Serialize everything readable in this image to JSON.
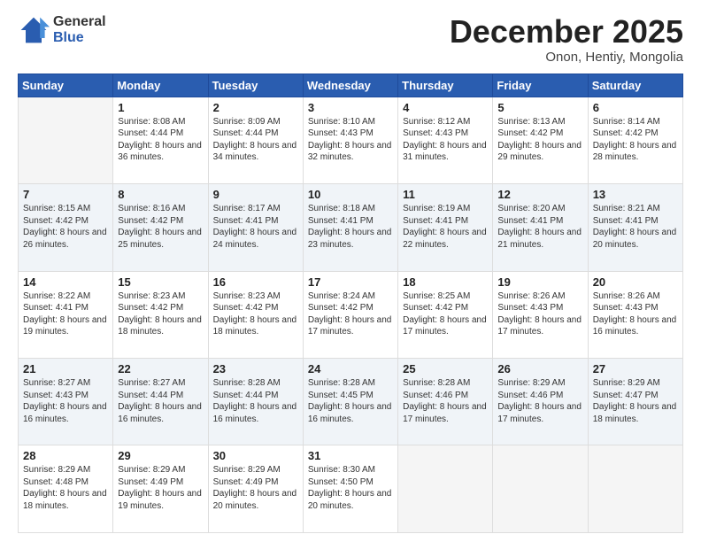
{
  "logo": {
    "general": "General",
    "blue": "Blue"
  },
  "header": {
    "month": "December 2025",
    "location": "Onon, Hentiy, Mongolia"
  },
  "weekdays": [
    "Sunday",
    "Monday",
    "Tuesday",
    "Wednesday",
    "Thursday",
    "Friday",
    "Saturday"
  ],
  "weeks": [
    [
      {
        "day": "",
        "empty": true
      },
      {
        "day": "1",
        "sunrise": "Sunrise: 8:08 AM",
        "sunset": "Sunset: 4:44 PM",
        "daylight": "Daylight: 8 hours and 36 minutes."
      },
      {
        "day": "2",
        "sunrise": "Sunrise: 8:09 AM",
        "sunset": "Sunset: 4:44 PM",
        "daylight": "Daylight: 8 hours and 34 minutes."
      },
      {
        "day": "3",
        "sunrise": "Sunrise: 8:10 AM",
        "sunset": "Sunset: 4:43 PM",
        "daylight": "Daylight: 8 hours and 32 minutes."
      },
      {
        "day": "4",
        "sunrise": "Sunrise: 8:12 AM",
        "sunset": "Sunset: 4:43 PM",
        "daylight": "Daylight: 8 hours and 31 minutes."
      },
      {
        "day": "5",
        "sunrise": "Sunrise: 8:13 AM",
        "sunset": "Sunset: 4:42 PM",
        "daylight": "Daylight: 8 hours and 29 minutes."
      },
      {
        "day": "6",
        "sunrise": "Sunrise: 8:14 AM",
        "sunset": "Sunset: 4:42 PM",
        "daylight": "Daylight: 8 hours and 28 minutes."
      }
    ],
    [
      {
        "day": "7",
        "sunrise": "Sunrise: 8:15 AM",
        "sunset": "Sunset: 4:42 PM",
        "daylight": "Daylight: 8 hours and 26 minutes."
      },
      {
        "day": "8",
        "sunrise": "Sunrise: 8:16 AM",
        "sunset": "Sunset: 4:42 PM",
        "daylight": "Daylight: 8 hours and 25 minutes."
      },
      {
        "day": "9",
        "sunrise": "Sunrise: 8:17 AM",
        "sunset": "Sunset: 4:41 PM",
        "daylight": "Daylight: 8 hours and 24 minutes."
      },
      {
        "day": "10",
        "sunrise": "Sunrise: 8:18 AM",
        "sunset": "Sunset: 4:41 PM",
        "daylight": "Daylight: 8 hours and 23 minutes."
      },
      {
        "day": "11",
        "sunrise": "Sunrise: 8:19 AM",
        "sunset": "Sunset: 4:41 PM",
        "daylight": "Daylight: 8 hours and 22 minutes."
      },
      {
        "day": "12",
        "sunrise": "Sunrise: 8:20 AM",
        "sunset": "Sunset: 4:41 PM",
        "daylight": "Daylight: 8 hours and 21 minutes."
      },
      {
        "day": "13",
        "sunrise": "Sunrise: 8:21 AM",
        "sunset": "Sunset: 4:41 PM",
        "daylight": "Daylight: 8 hours and 20 minutes."
      }
    ],
    [
      {
        "day": "14",
        "sunrise": "Sunrise: 8:22 AM",
        "sunset": "Sunset: 4:41 PM",
        "daylight": "Daylight: 8 hours and 19 minutes."
      },
      {
        "day": "15",
        "sunrise": "Sunrise: 8:23 AM",
        "sunset": "Sunset: 4:42 PM",
        "daylight": "Daylight: 8 hours and 18 minutes."
      },
      {
        "day": "16",
        "sunrise": "Sunrise: 8:23 AM",
        "sunset": "Sunset: 4:42 PM",
        "daylight": "Daylight: 8 hours and 18 minutes."
      },
      {
        "day": "17",
        "sunrise": "Sunrise: 8:24 AM",
        "sunset": "Sunset: 4:42 PM",
        "daylight": "Daylight: 8 hours and 17 minutes."
      },
      {
        "day": "18",
        "sunrise": "Sunrise: 8:25 AM",
        "sunset": "Sunset: 4:42 PM",
        "daylight": "Daylight: 8 hours and 17 minutes."
      },
      {
        "day": "19",
        "sunrise": "Sunrise: 8:26 AM",
        "sunset": "Sunset: 4:43 PM",
        "daylight": "Daylight: 8 hours and 17 minutes."
      },
      {
        "day": "20",
        "sunrise": "Sunrise: 8:26 AM",
        "sunset": "Sunset: 4:43 PM",
        "daylight": "Daylight: 8 hours and 16 minutes."
      }
    ],
    [
      {
        "day": "21",
        "sunrise": "Sunrise: 8:27 AM",
        "sunset": "Sunset: 4:43 PM",
        "daylight": "Daylight: 8 hours and 16 minutes."
      },
      {
        "day": "22",
        "sunrise": "Sunrise: 8:27 AM",
        "sunset": "Sunset: 4:44 PM",
        "daylight": "Daylight: 8 hours and 16 minutes."
      },
      {
        "day": "23",
        "sunrise": "Sunrise: 8:28 AM",
        "sunset": "Sunset: 4:44 PM",
        "daylight": "Daylight: 8 hours and 16 minutes."
      },
      {
        "day": "24",
        "sunrise": "Sunrise: 8:28 AM",
        "sunset": "Sunset: 4:45 PM",
        "daylight": "Daylight: 8 hours and 16 minutes."
      },
      {
        "day": "25",
        "sunrise": "Sunrise: 8:28 AM",
        "sunset": "Sunset: 4:46 PM",
        "daylight": "Daylight: 8 hours and 17 minutes."
      },
      {
        "day": "26",
        "sunrise": "Sunrise: 8:29 AM",
        "sunset": "Sunset: 4:46 PM",
        "daylight": "Daylight: 8 hours and 17 minutes."
      },
      {
        "day": "27",
        "sunrise": "Sunrise: 8:29 AM",
        "sunset": "Sunset: 4:47 PM",
        "daylight": "Daylight: 8 hours and 18 minutes."
      }
    ],
    [
      {
        "day": "28",
        "sunrise": "Sunrise: 8:29 AM",
        "sunset": "Sunset: 4:48 PM",
        "daylight": "Daylight: 8 hours and 18 minutes."
      },
      {
        "day": "29",
        "sunrise": "Sunrise: 8:29 AM",
        "sunset": "Sunset: 4:49 PM",
        "daylight": "Daylight: 8 hours and 19 minutes."
      },
      {
        "day": "30",
        "sunrise": "Sunrise: 8:29 AM",
        "sunset": "Sunset: 4:49 PM",
        "daylight": "Daylight: 8 hours and 20 minutes."
      },
      {
        "day": "31",
        "sunrise": "Sunrise: 8:30 AM",
        "sunset": "Sunset: 4:50 PM",
        "daylight": "Daylight: 8 hours and 20 minutes."
      },
      {
        "day": "",
        "empty": true
      },
      {
        "day": "",
        "empty": true
      },
      {
        "day": "",
        "empty": true
      }
    ]
  ]
}
